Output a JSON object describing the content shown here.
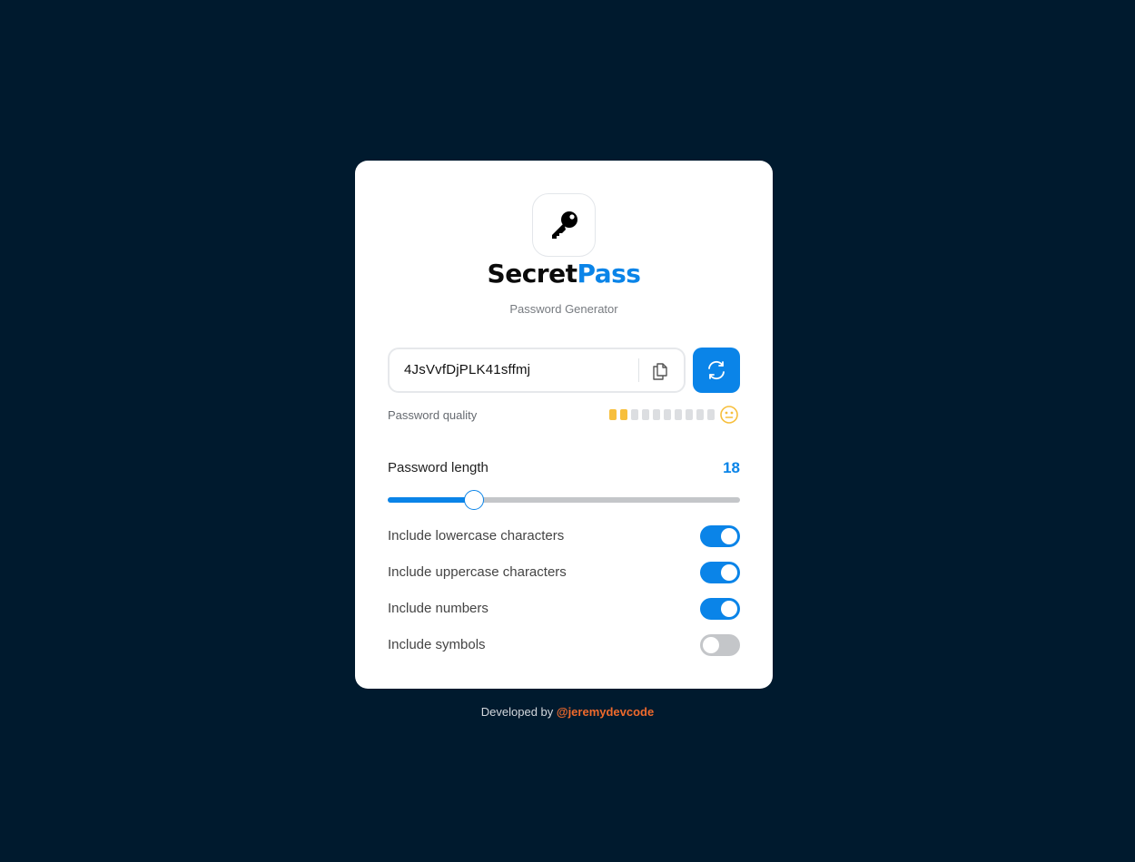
{
  "brand": {
    "name_part1": "Secret",
    "name_part2": "Pass",
    "subtitle": "Password Generator",
    "logo_icon": "key-icon"
  },
  "password": {
    "value": "4JsVvfDjPLK41sffmj",
    "copy_icon": "copy-icon",
    "refresh_icon": "refresh-icon"
  },
  "quality": {
    "label": "Password quality",
    "filled_segments": 2,
    "total_segments": 10,
    "status_icon": "neutral-face-icon",
    "color": "#f7bf3c"
  },
  "length": {
    "label": "Password length",
    "value": "18",
    "slider_fraction": 0.245
  },
  "options": [
    {
      "label": "Include lowercase characters",
      "enabled": true
    },
    {
      "label": "Include uppercase characters",
      "enabled": true
    },
    {
      "label": "Include numbers",
      "enabled": true
    },
    {
      "label": "Include symbols",
      "enabled": false
    }
  ],
  "footer": {
    "prefix": "Developed by",
    "author": "@jeremydevcode"
  },
  "colors": {
    "accent": "#0a84e8",
    "background": "#001a2e",
    "author_link": "#ef6a2c"
  }
}
